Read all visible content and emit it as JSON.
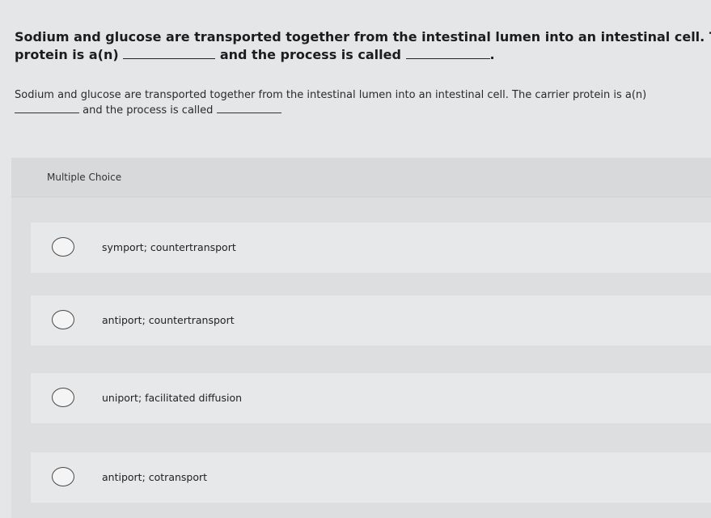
{
  "question": {
    "header_line1": "Sodium and glucose are transported together from the intestinal lumen into an intestinal cell. The ca",
    "header_line2_part1": "protein is a(n)",
    "header_line2_part2": "and the process is called",
    "header_line2_part3": ".",
    "body_line1": "Sodium and glucose are transported together from the intestinal lumen into an intestinal cell. The carrier protein is a(n)",
    "body_line2_part1": "and the process is called"
  },
  "multiple_choice": {
    "label": "Multiple Choice",
    "options": [
      {
        "label": "symport; countertransport"
      },
      {
        "label": "antiport; countertransport"
      },
      {
        "label": "uniport; facilitated diffusion"
      },
      {
        "label": "antiport; cotransport"
      }
    ]
  }
}
